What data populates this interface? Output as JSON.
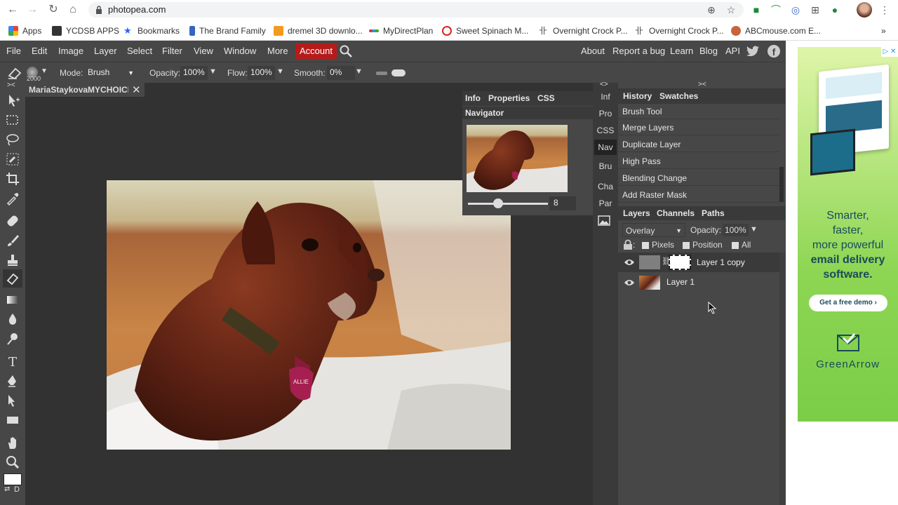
{
  "browser": {
    "url": "photopea.com",
    "bookmarks": [
      "Apps",
      "YCDSB APPS",
      "Bookmarks",
      "The Brand Family",
      "dremel 3D downlo...",
      "MyDirectPlan",
      "Sweet Spinach M...",
      "Overnight Crock P...",
      "Overnight Crock P...",
      "ABCmouse.com E..."
    ],
    "more": "»"
  },
  "menubar": {
    "left": [
      "File",
      "Edit",
      "Image",
      "Layer",
      "Select",
      "Filter",
      "View",
      "Window",
      "More"
    ],
    "account": "Account",
    "right": [
      "About",
      "Report a bug",
      "Learn",
      "Blog",
      "API"
    ]
  },
  "options": {
    "brush_size": "2000",
    "mode_label": "Mode:",
    "mode_value": "Brush",
    "opacity_label": "Opacity:",
    "opacity_value": "100%",
    "flow_label": "Flow:",
    "flow_value": "100%",
    "smooth_label": "Smooth:",
    "smooth_value": "0%"
  },
  "document": {
    "tab_name": "MariaStaykovaMYCHOICE",
    "close": "✕"
  },
  "navigator": {
    "tabs": [
      "Info",
      "Properties",
      "CSS"
    ],
    "title": "Navigator",
    "zoom": "8"
  },
  "strip": [
    "Inf",
    "Pro",
    "CSS",
    "Nav",
    "Bru",
    "Cha",
    "Par"
  ],
  "history": {
    "tabs": [
      "History",
      "Swatches"
    ],
    "items": [
      "Brush Tool",
      "Merge Layers",
      "Duplicate Layer",
      "High Pass",
      "Blending Change",
      "Add Raster Mask"
    ]
  },
  "layers": {
    "tabs": [
      "Layers",
      "Channels",
      "Paths"
    ],
    "blend_mode": "Overlay",
    "opacity_label": "Opacity:",
    "opacity_value": "100%",
    "lock_options": [
      "Pixels",
      "Position",
      "All"
    ],
    "items": [
      "Layer 1 copy",
      "Layer 1"
    ]
  },
  "ad": {
    "headline_lines": [
      "Smarter,",
      "faster,",
      "more powerful"
    ],
    "bold_lines": [
      "email delivery",
      "software."
    ],
    "cta": "Get a free demo ›",
    "brand": "GreenArrow"
  },
  "colors": {
    "accent_account": "#b61b1b",
    "panel_bg": "#474747",
    "canvas_bg": "#323232"
  }
}
